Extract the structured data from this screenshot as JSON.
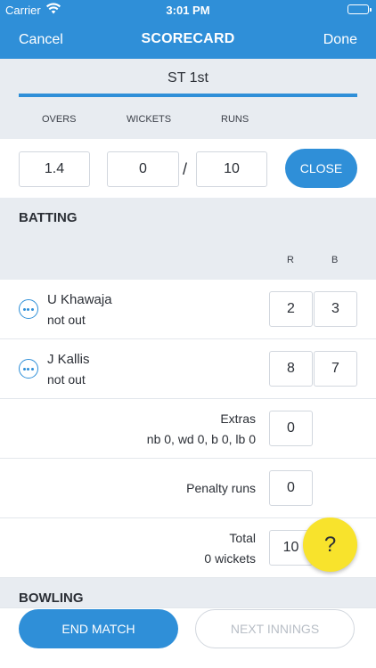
{
  "status_bar": {
    "carrier": "Carrier",
    "time": "3:01 PM"
  },
  "navbar": {
    "left": "Cancel",
    "title": "SCORECARD",
    "right": "Done"
  },
  "innings_tab": {
    "label": "ST 1st"
  },
  "score_header": {
    "overs": "OVERS",
    "wickets": "WICKETS",
    "runs": "RUNS"
  },
  "score": {
    "overs": "1.4",
    "wickets": "0",
    "separator": "/",
    "runs": "10",
    "close_label": "CLOSE"
  },
  "batting": {
    "header": "BATTING",
    "col_r": "R",
    "col_b": "B",
    "players": [
      {
        "name": "U Khawaja",
        "status": "not out",
        "runs": "2",
        "balls": "3"
      },
      {
        "name": "J Kallis",
        "status": "not out",
        "runs": "8",
        "balls": "7"
      }
    ],
    "extras": {
      "label": "Extras",
      "detail": "nb 0, wd 0, b 0, lb 0",
      "value": "0"
    },
    "penalty": {
      "label": "Penalty runs",
      "value": "0"
    },
    "total": {
      "label": "Total",
      "detail": "0 wickets",
      "value": "10"
    }
  },
  "bowling": {
    "header": "BOWLING"
  },
  "help": {
    "label": "?"
  },
  "bottom": {
    "end_label": "END MATCH",
    "next_label": "NEXT INNINGS"
  },
  "colors": {
    "primary": "#2f8fd8",
    "fab": "#f8e32c",
    "background": "#e8ecf1"
  }
}
